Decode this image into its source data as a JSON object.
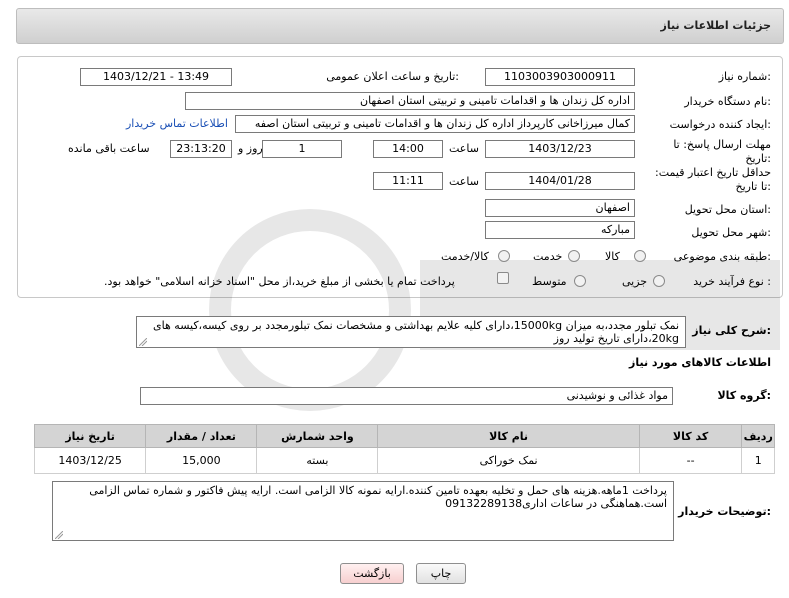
{
  "header": {
    "title": "جزئیات اطلاعات نیاز"
  },
  "form": {
    "need_number_label": "شماره نیاز:",
    "need_number": "1103003903000911",
    "announce_label": "تاریخ و ساعت اعلان عمومی:",
    "announce_value": "1403/12/21 - 13:49",
    "buyer_label": "نام دستگاه خریدار:",
    "buyer_value": "اداره کل زندان ها و اقدامات تامینی و تربیتی استان اصفهان",
    "creator_label": "ایجاد کننده درخواست:",
    "creator_value": "کمال میرزاخانی کارپرداز اداره کل زندان ها و اقدامات تامینی و تربیتی استان اصفه",
    "contact_link": "اطلاعات تماس خریدار",
    "deadline_label": "مهلت ارسال پاسخ: تا تاریخ:",
    "deadline_date": "1403/12/23",
    "time_label": "ساعت",
    "deadline_time": "14:00",
    "days_value": "1",
    "days_label": "روز و",
    "remaining_value": "23:13:20",
    "remaining_label": "ساعت باقی مانده",
    "validity_label": "حداقل تاریخ اعتبار قیمت: تا تاریخ:",
    "validity_date": "1404/01/28",
    "validity_time": "11:11",
    "province_label": "استان محل تحویل:",
    "province_value": "اصفهان",
    "city_label": "شهر محل تحویل:",
    "city_value": "مبارکه",
    "category_label": "طبقه بندی موضوعی:",
    "category_options": [
      "کالا",
      "خدمت",
      "کالا/خدمت"
    ],
    "process_label": "نوع فرآیند خرید :",
    "process_options": [
      "جزیی",
      "متوسط"
    ],
    "payment_note": "پرداخت تمام یا بخشی از مبلغ خرید،از محل \"اسناد خزانه اسلامی\" خواهد بود."
  },
  "description": {
    "label": "شرح کلی نیاز:",
    "text": "نمک تبلور مجدد،به میزان 15000kg،دارای کلیه علایم بهداشتی و مشخصات نمک تبلورمجدد بر روی کیسه،کیسه های 20kg،دارای تاریخ تولید روز"
  },
  "goods": {
    "section_title": "اطلاعات کالاهای مورد نیاز",
    "group_label": "گروه کالا:",
    "group_value": "مواد غذائی و نوشیدنی",
    "columns": [
      "ردیف",
      "کد کالا",
      "نام کالا",
      "واحد شمارش",
      "تعداد / مقدار",
      "تاریخ نیاز"
    ],
    "rows": [
      [
        "1",
        "--",
        "نمک خوراکی",
        "بسته",
        "15,000",
        "1403/12/25"
      ]
    ]
  },
  "buyer_notes": {
    "label": "توضیحات خریدار:",
    "text": "پرداخت 1ماهه.هزینه های حمل و تخلیه بعهده تامین کننده.ارایه نمونه کالا الزامی است. ارایه پیش فاکتور و شماره تماس الزامی است.هماهنگی در ساعات اداری09132289138"
  },
  "buttons": {
    "print": "چاپ",
    "back": "بازگشت"
  },
  "colors": {
    "link": "#1a4fb5",
    "back_button_bg": "#fde0e0"
  }
}
